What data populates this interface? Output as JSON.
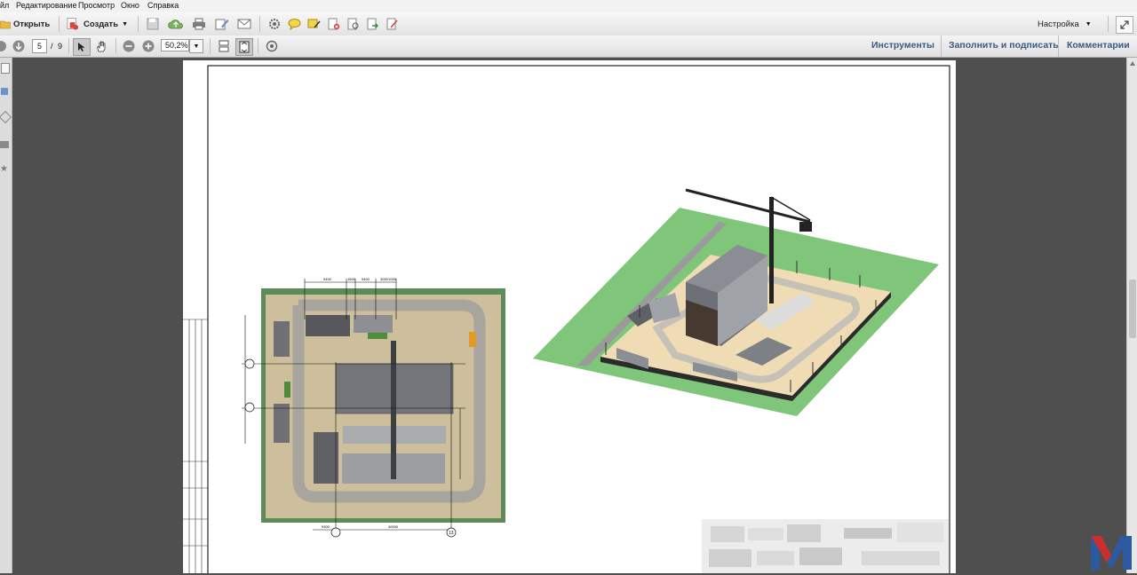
{
  "menu": {
    "items": [
      "йл",
      "Редактирование",
      "Просмотр",
      "Окно",
      "Справка"
    ]
  },
  "toolbar": {
    "open_label": "Открыть",
    "create_label": "Создать",
    "customize_label": "Настройка",
    "icons": [
      "folder-icon",
      "create-pdf-icon",
      "save-icon",
      "cloud-upload-icon",
      "print-icon",
      "edit-icon",
      "email-icon",
      "gear-icon",
      "comment-icon",
      "highlight-icon",
      "stamp-icon",
      "attach-icon",
      "export-icon",
      "signature-icon"
    ]
  },
  "navigation": {
    "current_page": "5",
    "page_separator": "/",
    "total_pages": "9",
    "zoom": "50,2%"
  },
  "panels": {
    "tools_label": "Инструменты",
    "fill_sign_label": "Заполнить и подписать",
    "comments_label": "Комментарии"
  },
  "document": {
    "plan_dimension_labels": [
      "9400",
      "1500",
      "9400",
      "3000",
      "1000",
      "9300",
      "40000",
      "13"
    ],
    "colors": {
      "grass": "#7fc67a",
      "sand": "#f0dcb4",
      "road": "#b9b4ab",
      "building": "#555a62",
      "plan_ground": "#cdbf9c",
      "plan_border": "#5e8c58"
    }
  },
  "colors": {
    "accent_link": "#3a5a84",
    "logo_red": "#c9302c",
    "logo_blue": "#2c5aa0"
  }
}
